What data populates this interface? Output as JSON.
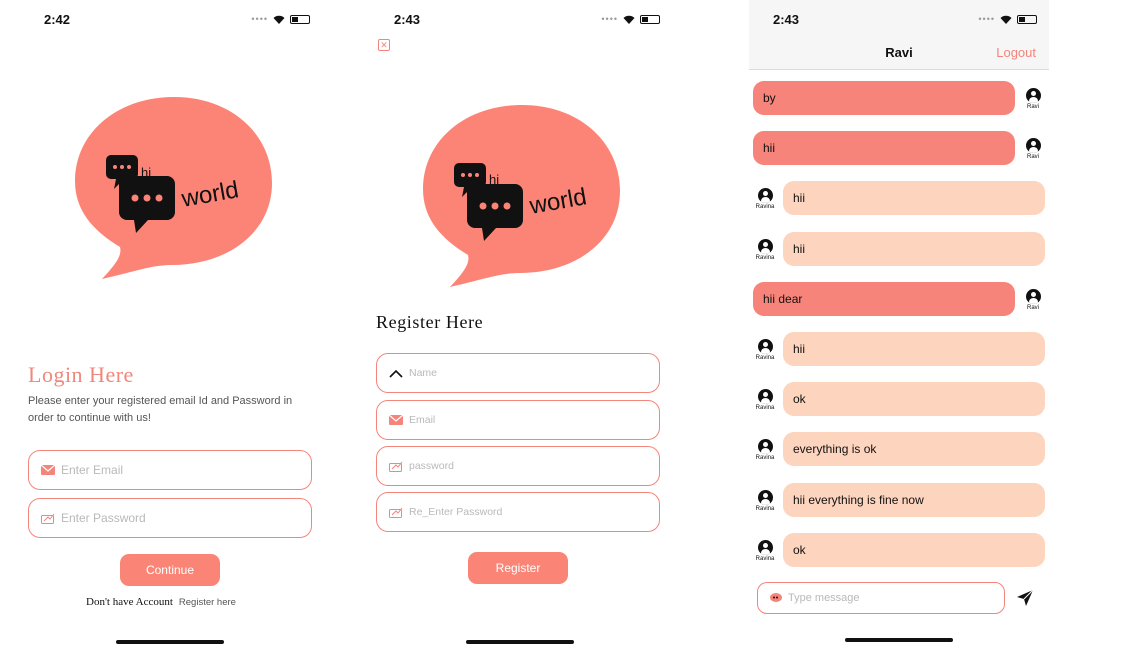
{
  "login": {
    "time": "2:42",
    "logo_hi": "hi",
    "logo_world": "world",
    "title": "Login Here",
    "subtitle": "Please enter your registered email Id and Password in order to continue with us!",
    "email_placeholder": "Enter Email",
    "password_placeholder": "Enter Password",
    "continue_label": "Continue",
    "no_account": "Don't have Account",
    "register_link": "Register here"
  },
  "register": {
    "time": "2:43",
    "logo_hi": "hi",
    "logo_world": "world",
    "title": "Register Here",
    "name_placeholder": "Name",
    "email_placeholder": "Email",
    "password_placeholder": "password",
    "reenter_placeholder": "Re_Enter Password",
    "register_label": "Register"
  },
  "chat": {
    "time": "2:43",
    "title": "Ravi",
    "logout_label": "Logout",
    "messages": [
      {
        "text": "by",
        "sender": "Ravi",
        "mine": true
      },
      {
        "text": "hii",
        "sender": "Ravi",
        "mine": true
      },
      {
        "text": "hii",
        "sender": "Ravina",
        "mine": false
      },
      {
        "text": "hii",
        "sender": "Ravina",
        "mine": false
      },
      {
        "text": "hii dear",
        "sender": "Ravi",
        "mine": true
      },
      {
        "text": "hii",
        "sender": "Ravina",
        "mine": false
      },
      {
        "text": "ok",
        "sender": "Ravina",
        "mine": false
      },
      {
        "text": "everything is ok",
        "sender": "Ravina",
        "mine": false
      },
      {
        "text": "hii everything is fine now",
        "sender": "Ravina",
        "mine": false
      },
      {
        "text": "ok",
        "sender": "Ravina",
        "mine": false
      }
    ],
    "input_placeholder": "Type message"
  },
  "colors": {
    "accent": "#fa8577",
    "bubble_mine": "#f7847a",
    "bubble_theirs": "#fdd4bd",
    "logo_fill": "#fc8476"
  },
  "icons": [
    "wifi-icon",
    "battery-icon",
    "envelope-icon",
    "key-icon",
    "chevron-up-icon",
    "close-icon",
    "user-avatar-icon",
    "send-icon",
    "chat-bubble-icon"
  ]
}
